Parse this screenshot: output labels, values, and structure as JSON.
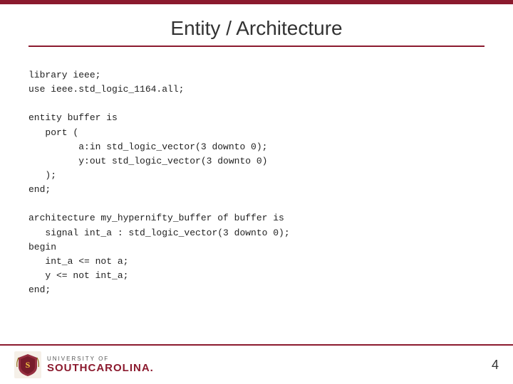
{
  "slide": {
    "top_border_color": "#8b1a2e",
    "title": "Entity / Architecture",
    "code": "library ieee;\nuse ieee.std_logic_1164.all;\n\nentity buffer is\n   port (\n         a:in std_logic_vector(3 downto 0);\n         y:out std_logic_vector(3 downto 0)\n   );\nend;\n\narchitecture my_hypernifty_buffer of buffer is\n   signal int_a : std_logic_vector(3 downto 0);\nbegin\n   int_a <= not a;\n   y <= not int_a;\nend;",
    "footer": {
      "university_of": "UNIVERSITY OF",
      "south_carolina": "SOUTHCAROLINA.",
      "page_number": "4"
    }
  }
}
